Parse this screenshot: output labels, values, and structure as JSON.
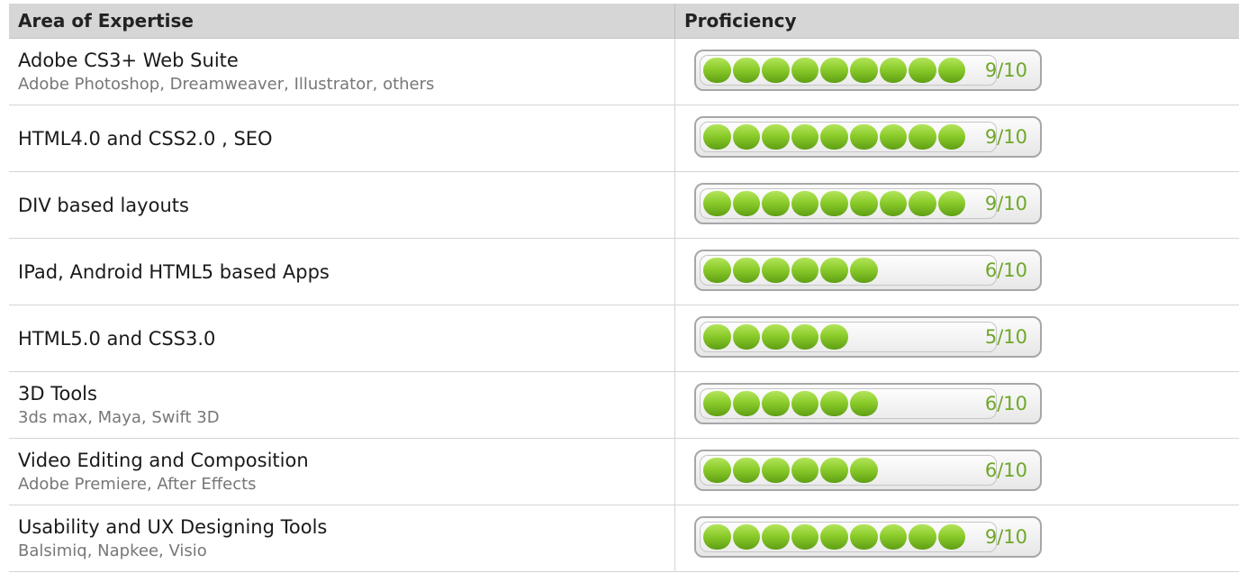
{
  "table": {
    "headers": {
      "area": "Area of Expertise",
      "proficiency": "Proficiency"
    },
    "rows": [
      {
        "title": "Adobe CS3+ Web Suite",
        "subtitle": "Adobe Photoshop, Dreamweaver, Illustrator, others",
        "score_label": "9/10",
        "score": 9,
        "max": 10
      },
      {
        "title": "HTML4.0 and CSS2.0 , SEO",
        "subtitle": "",
        "score_label": "9/10",
        "score": 9,
        "max": 10
      },
      {
        "title": "DIV based layouts",
        "subtitle": "",
        "score_label": "9/10",
        "score": 9,
        "max": 10
      },
      {
        "title": "IPad, Android HTML5 based Apps",
        "subtitle": "",
        "score_label": "6/10",
        "score": 6,
        "max": 10
      },
      {
        "title": "HTML5.0 and CSS3.0",
        "subtitle": "",
        "score_label": "5/10",
        "score": 5,
        "max": 10
      },
      {
        "title": "3D Tools",
        "subtitle": "3ds max, Maya, Swift 3D",
        "score_label": "6/10",
        "score": 6,
        "max": 10
      },
      {
        "title": "Video Editing and Composition",
        "subtitle": "Adobe Premiere, After Effects",
        "score_label": "6/10",
        "score": 6,
        "max": 10
      },
      {
        "title": "Usability and UX Designing Tools",
        "subtitle": "Balsimiq, Napkee, Visio",
        "score_label": "9/10",
        "score": 9,
        "max": 10
      }
    ]
  },
  "colors": {
    "header_bg": "#d6d6d6",
    "score_text": "#6fa728",
    "pill_green": "#8bcc2b"
  }
}
